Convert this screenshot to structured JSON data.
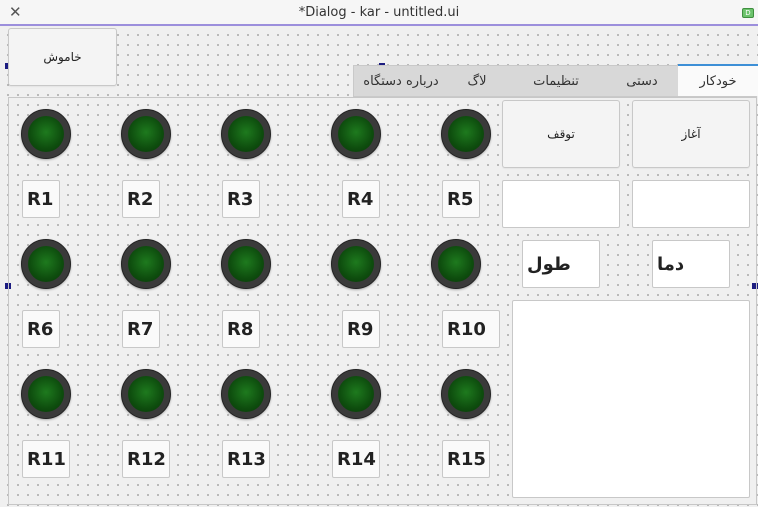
{
  "window": {
    "title": "*Dialog - kar - untitled.ui",
    "close_icon": "close-icon",
    "badge": "D"
  },
  "buttons": {
    "off": "خاموش",
    "start": "آغاز",
    "stop": "توقف"
  },
  "tabs": [
    {
      "label": "خودکار",
      "active": true
    },
    {
      "label": "دستی",
      "active": false
    },
    {
      "label": "تنظیمات",
      "active": false
    },
    {
      "label": "لاگ",
      "active": false
    },
    {
      "label": "درباره دستگاه",
      "active": false
    }
  ],
  "relays": [
    "R1",
    "R2",
    "R3",
    "R4",
    "R5",
    "R6",
    "R7",
    "R8",
    "R9",
    "R10",
    "R11",
    "R12",
    "R13",
    "R14",
    "R15"
  ],
  "labels": {
    "temp": "دما",
    "length": "طول"
  },
  "colors": {
    "accent": "#3d8fd6",
    "led_off": "#0e4d0e",
    "selection": "#1c1c80"
  }
}
